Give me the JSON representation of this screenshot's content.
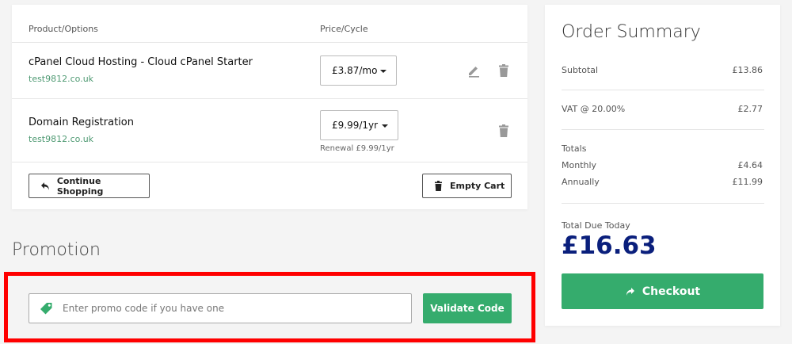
{
  "cart": {
    "header_product": "Product/Options",
    "header_price": "Price/Cycle",
    "items": [
      {
        "name": "cPanel Cloud Hosting - Cloud cPanel Starter",
        "domain": "test9812.co.uk",
        "price": "£3.87/mo",
        "renewal": ""
      },
      {
        "name": "Domain Registration",
        "domain": "test9812.co.uk",
        "price": "£9.99/1yr",
        "renewal": "Renewal £9.99/1yr"
      }
    ],
    "continue_label": "Continue Shopping",
    "empty_label": "Empty Cart"
  },
  "promotion": {
    "title": "Promotion",
    "placeholder": "Enter promo code if you have one",
    "validate_label": "Validate Code",
    "highlight_color": "#ff0000"
  },
  "summary": {
    "title": "Order Summary",
    "subtotal_label": "Subtotal",
    "subtotal_value": "£13.86",
    "vat_label": "VAT @ 20.00%",
    "vat_value": "£2.77",
    "totals_label": "Totals",
    "monthly_label": "Monthly",
    "monthly_value": "£4.64",
    "annually_label": "Annually",
    "annually_value": "£11.99",
    "due_label": "Total Due Today",
    "due_value": "£16.63",
    "checkout_label": "Checkout"
  },
  "colors": {
    "accent_green": "#35ac6d",
    "total_blue": "#0a1f7c",
    "domain_green": "#4f9a73"
  },
  "icons": [
    "edit-icon",
    "trash-icon",
    "back-arrow-icon",
    "tag-icon",
    "forward-arrow-icon"
  ]
}
